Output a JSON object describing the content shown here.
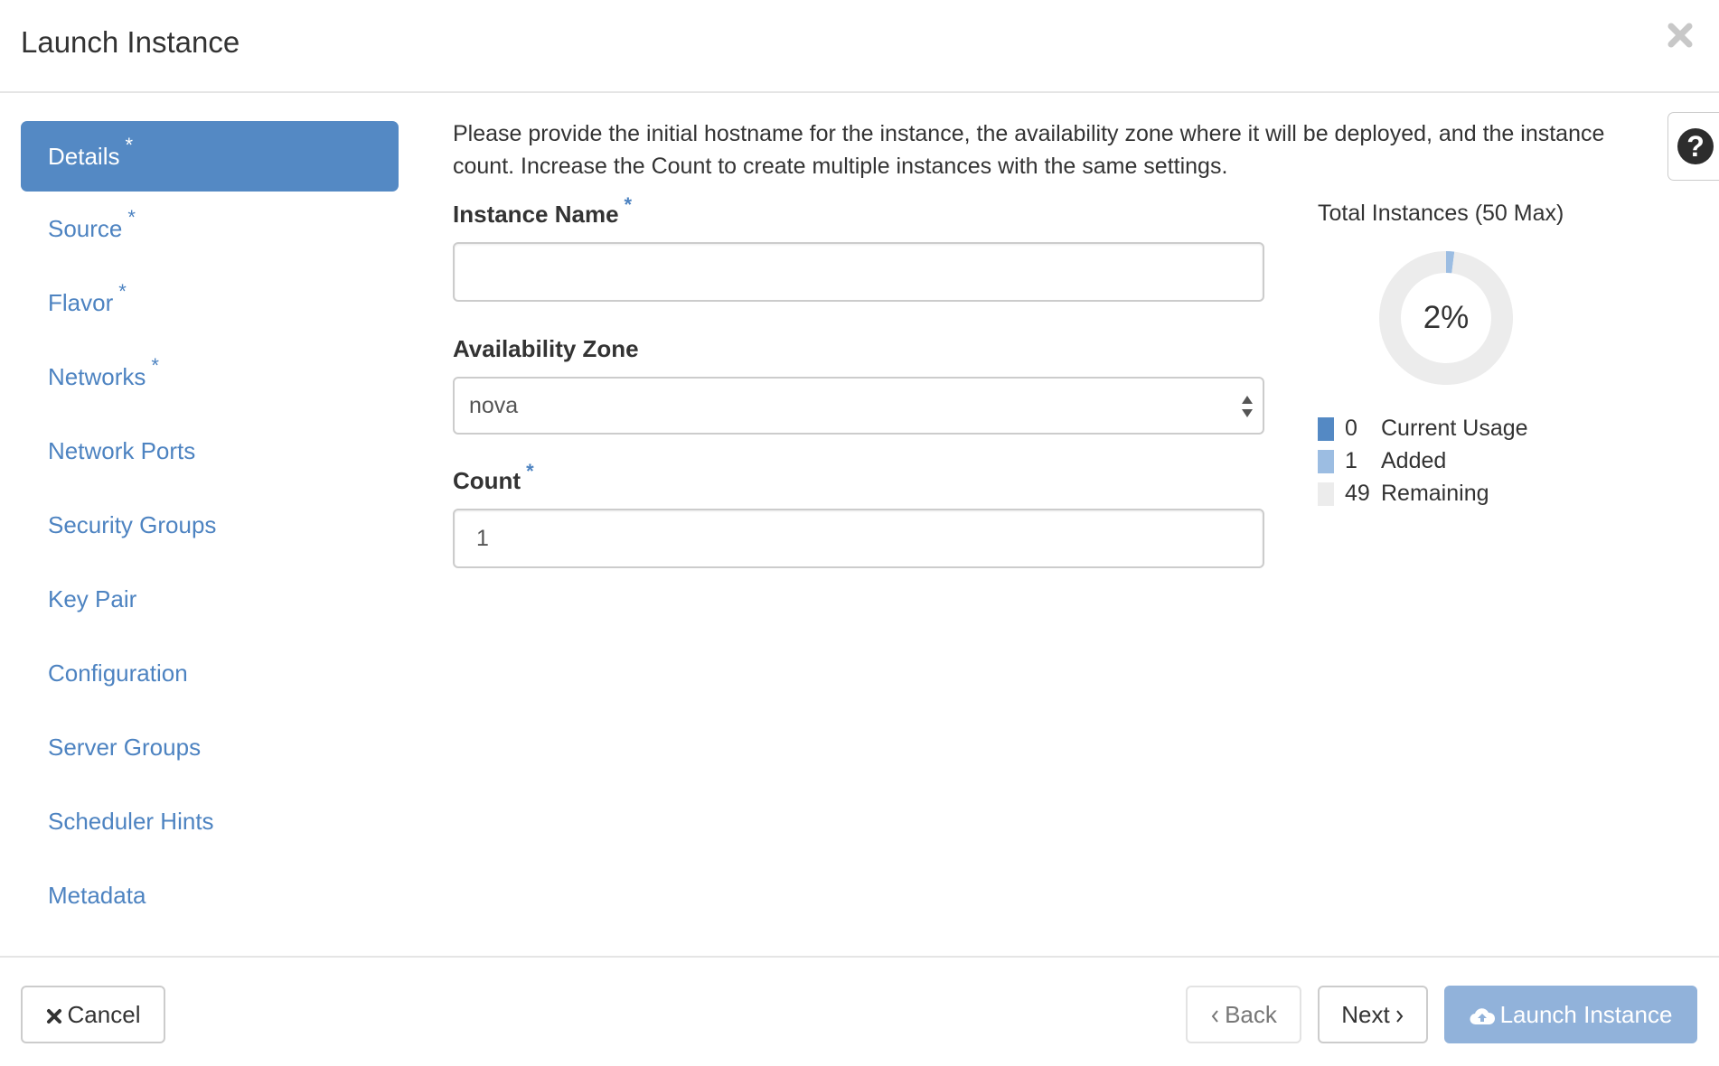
{
  "header": {
    "title": "Launch Instance",
    "close_icon": "close-icon"
  },
  "sidebar": {
    "items": [
      {
        "label": "Details",
        "required": "*",
        "active": true
      },
      {
        "label": "Source",
        "required": "*"
      },
      {
        "label": "Flavor",
        "required": "*"
      },
      {
        "label": "Networks",
        "required": "*"
      },
      {
        "label": "Network Ports",
        "required": ""
      },
      {
        "label": "Security Groups",
        "required": ""
      },
      {
        "label": "Key Pair",
        "required": ""
      },
      {
        "label": "Configuration",
        "required": ""
      },
      {
        "label": "Server Groups",
        "required": ""
      },
      {
        "label": "Scheduler Hints",
        "required": ""
      },
      {
        "label": "Metadata",
        "required": ""
      }
    ]
  },
  "main": {
    "description": "Please provide the initial hostname for the instance, the availability zone where it will be deployed, and the instance count. Increase the Count to create multiple instances with the same settings.",
    "help_icon": "question-circle-icon",
    "help_glyph": "?"
  },
  "form": {
    "instance_name": {
      "label": "Instance Name",
      "required": "*",
      "value": "",
      "placeholder": ""
    },
    "availability_zone": {
      "label": "Availability Zone",
      "selected": "nova"
    },
    "count": {
      "label": "Count",
      "required": "*",
      "value": "1"
    }
  },
  "colors": {
    "accent": "#5489c4",
    "link": "#4d83c1",
    "current_usage": "#5489c4",
    "added": "#9cbde2",
    "remaining": "#ececec",
    "launch_disabled": "#91b2da"
  },
  "chart_data": {
    "type": "pie",
    "title": "Total Instances (50 Max)",
    "center_label": "2%",
    "max": 50,
    "series": [
      {
        "name": "Current Usage",
        "value": 0,
        "color": "#5489c4"
      },
      {
        "name": "Added",
        "value": 1,
        "color": "#9cbde2"
      },
      {
        "name": "Remaining",
        "value": 49,
        "color": "#ececec"
      }
    ],
    "legend": [
      {
        "value": "0",
        "label": "Current Usage"
      },
      {
        "value": "1",
        "label": "Added"
      },
      {
        "value": "49",
        "label": "Remaining"
      }
    ],
    "legend_position": "bottom"
  },
  "footer": {
    "cancel_label": "Cancel",
    "back_label": "Back",
    "next_label": "Next",
    "launch_label": "Launch Instance"
  }
}
